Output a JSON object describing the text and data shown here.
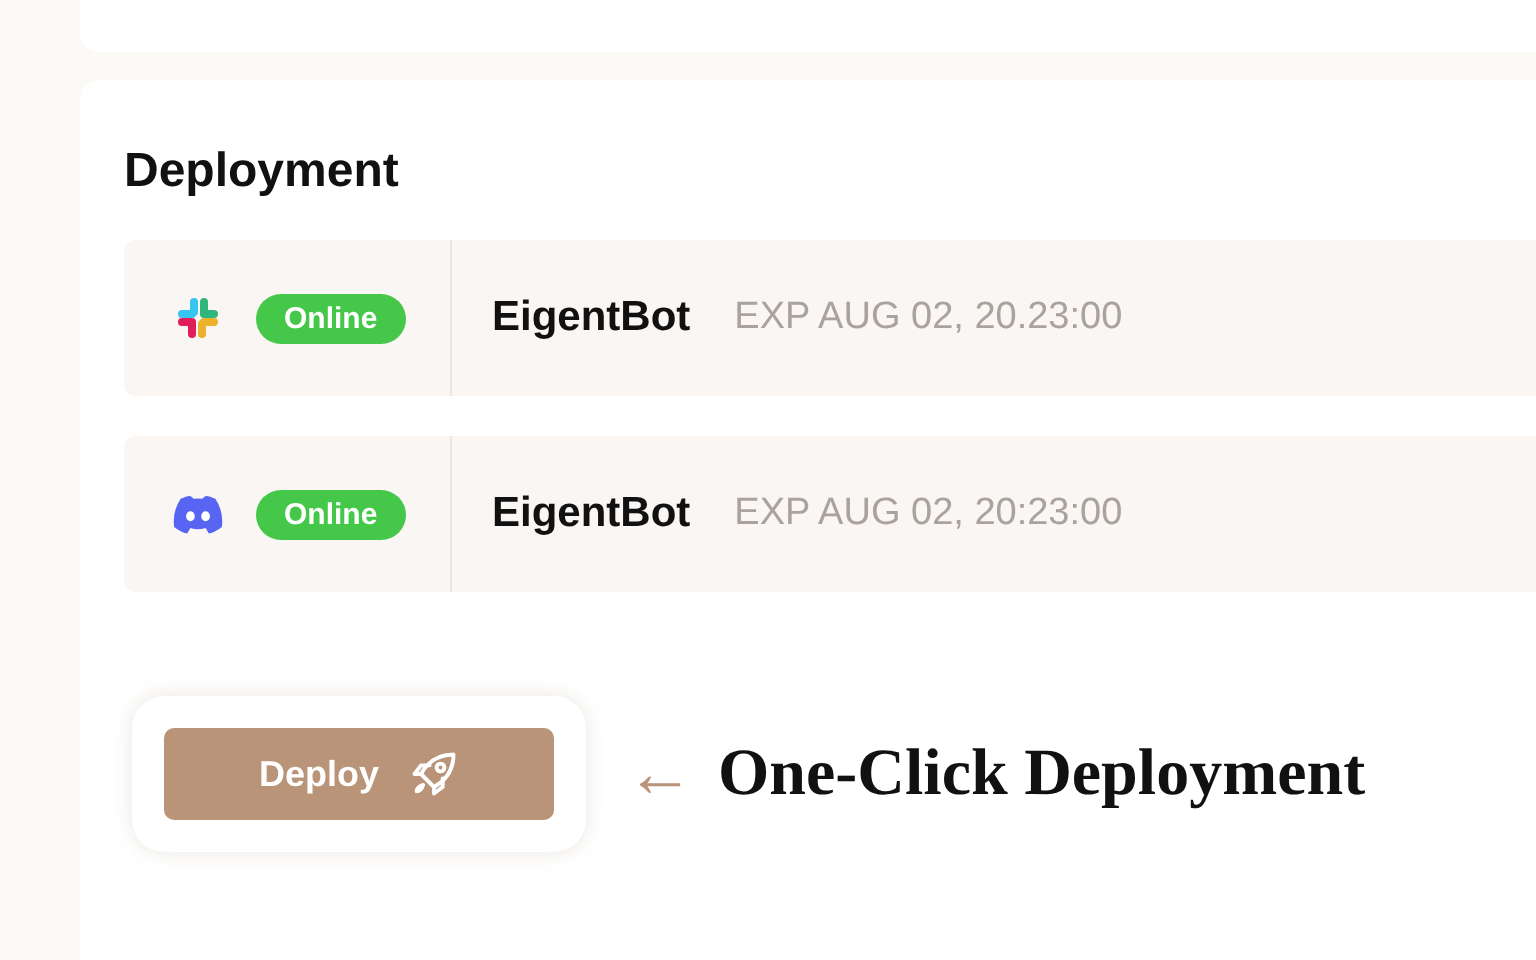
{
  "section": {
    "title": "Deployment"
  },
  "deployments": [
    {
      "kind": "slack",
      "status": "Online",
      "name": "EigentBot",
      "expiry": "EXP AUG 02, 20.23:00"
    },
    {
      "kind": "discord",
      "status": "Online",
      "name": "EigentBot",
      "expiry": "EXP AUG 02, 20:23:00"
    }
  ],
  "deploy_button": {
    "label": "Deploy"
  },
  "annotation": {
    "arrow": "←",
    "text": "One-Click Deployment"
  }
}
